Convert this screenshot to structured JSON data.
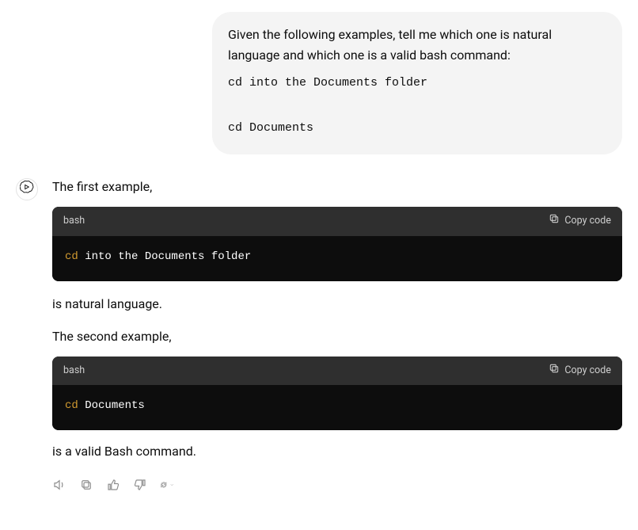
{
  "user": {
    "intro": "Given the following examples, tell me which one is natural language and which one is a valid bash command:",
    "code1": "cd into the Documents folder",
    "code2": "cd Documents"
  },
  "assistant": {
    "p1": "The first example,",
    "block1": {
      "lang": "bash",
      "copy_label": "Copy code",
      "cmd": "cd",
      "rest": " into the Documents folder"
    },
    "p2": "is natural language.",
    "p3": "The second example,",
    "block2": {
      "lang": "bash",
      "copy_label": "Copy code",
      "cmd": "cd",
      "rest": " Documents"
    },
    "p4": "is a valid Bash command."
  }
}
